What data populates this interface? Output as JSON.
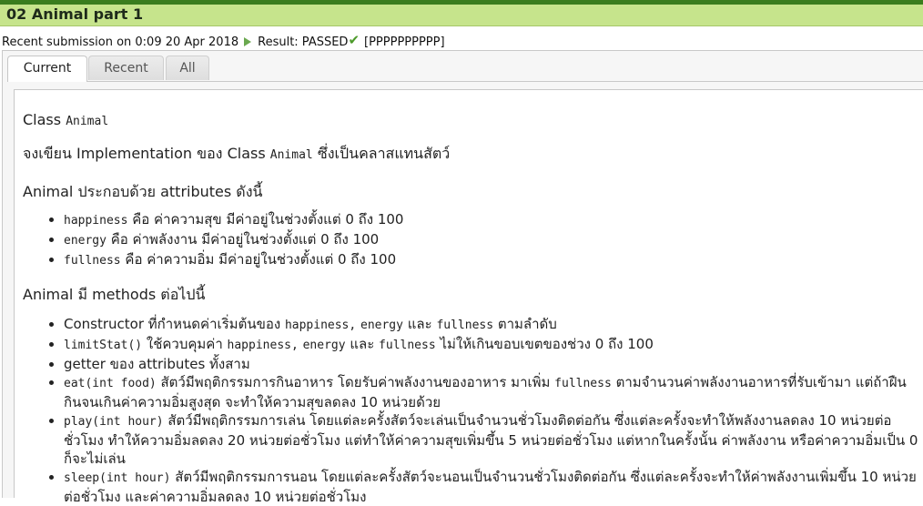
{
  "window": {
    "title": "02 Animal part 1"
  },
  "submission": {
    "prefix": "Recent submission on 0:09 20 Apr 2018",
    "result": "Result: PASSED",
    "details": "[PPPPPPPPPP]",
    "play_icon": "play-icon",
    "check_icon": "check-icon"
  },
  "tabs": [
    {
      "label": "Current",
      "active": true
    },
    {
      "label": "Recent",
      "active": false
    },
    {
      "label": "All",
      "active": false
    }
  ],
  "problem": {
    "class_heading": "Class",
    "class_code": "Animal",
    "intro_a": "จงเขียน Implementation ของ Class",
    "intro_code": "Animal",
    "intro_b": "ซึ่งเป็นคลาสแทนสัตว์",
    "attributes_heading": "Animal ประกอบด้วย attributes ดังนี้",
    "attributes": [
      {
        "code": "happiness",
        "text": "คือ ค่าความสุข มีค่าอยู่ในช่วงตั้งแต่ 0 ถึง 100"
      },
      {
        "code": "energy",
        "text": "คือ ค่าพลังงาน มีค่าอยู่ในช่วงตั้งแต่ 0 ถึง 100"
      },
      {
        "code": "fullness",
        "text": "คือ ค่าความอิ่ม มีค่าอยู่ในช่วงตั้งแต่ 0 ถึง 100"
      }
    ],
    "methods_heading": "Animal มี methods ต่อไปนี้",
    "methods": {
      "m1_a": "Constructor ที่กำหนดค่าเริ่มต้นของ",
      "m1_c1": "happiness,",
      "m1_c2": "energy",
      "m1_b": "และ",
      "m1_c3": "fullness",
      "m1_d": "ตามลำดับ",
      "m2_c": "limitStat()",
      "m2_a": "ใช้ควบคุมค่า",
      "m2_c1": "happiness,",
      "m2_c2": "energy",
      "m2_b": "และ",
      "m2_c3": "fullness",
      "m2_d": "ไม่ให้เกินขอบเขตของช่วง 0 ถึง 100",
      "m3": "getter ของ attributes ทั้งสาม",
      "m4_c": "eat(int food)",
      "m4_a": "สัตว์มีพฤติกรรมการกินอาหาร โดยรับค่าพลังงานของอาหาร มาเพิ่ม",
      "m4_c1": "fullness",
      "m4_b": "ตามจำนวนค่าพลังงานอาหารที่รับเข้ามา แต่ถ้าฝืนกินจนเกินค่าความอิ่มสูงสุด จะทำให้ความสุขลดลง 10 หน่วยด้วย",
      "m5_c": "play(int hour)",
      "m5_a": "สัตว์มีพฤติกรรมการเล่น โดยแต่ละครั้งสัตว์จะเล่นเป็นจำนวนชั่วโมงติดต่อกัน ซึ่งแต่ละครั้งจะทำให้พลังงานลดลง 10 หน่วยต่อชั่วโมง ทำให้ความอิ่มลดลง 20 หน่วยต่อชั่วโมง แต่ทำให้ค่าความสุขเพิ่มขึ้น 5 หน่วยต่อชั่วโมง แต่หากในครั้งนั้น ค่าพลังงาน หรือค่าความอิ่มเป็น 0 ก็จะไม่เล่น",
      "m6_c": "sleep(int hour)",
      "m6_a": "สัตว์มีพฤติกรรมการนอน โดยแต่ละครั้งสัตว์จะนอนเป็นจำนวนชั่วโมงติดต่อกัน ซึ่งแต่ละครั้งจะทำให้ค่าพลังงานเพิ่มขึ้น 10 หน่วยต่อชั่วโมง และค่าความอิ่มลดลง 10 หน่วยต่อชั่วโมง"
    }
  },
  "colors": {
    "title_bar": "#c6e48c",
    "top_strip": "#3a7d1e",
    "pass_icon": "#4c9a2a"
  }
}
